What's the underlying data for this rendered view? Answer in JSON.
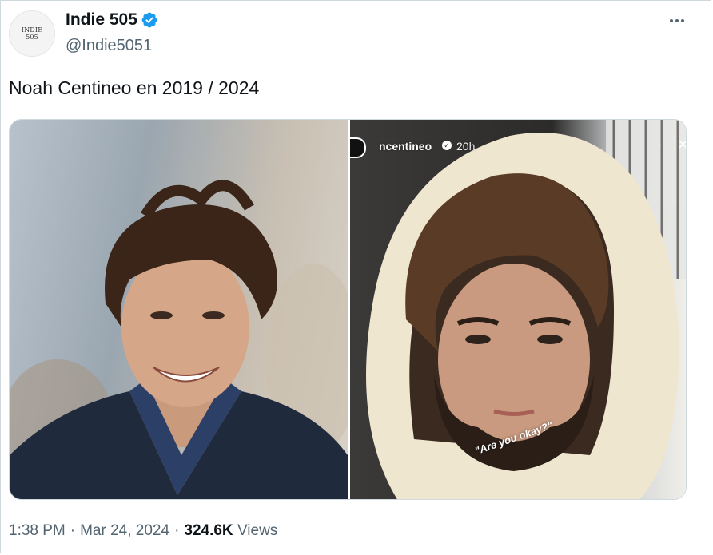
{
  "author": {
    "avatar_text_line1": "INDIE",
    "avatar_text_line2": "505",
    "display_name": "Indie 505",
    "handle": "@Indie5051",
    "verified_icon": "verified-badge-icon",
    "verified_color": "#1d9bf0"
  },
  "menu": {
    "more_icon": "more-horizontal-icon"
  },
  "tweet": {
    "text": "Noah Centineo en 2019 / 2024"
  },
  "media": {
    "left_photo": "photo-2019",
    "right_photo": {
      "story_username": "ncentineo",
      "story_verified": "✓",
      "story_time": "20h",
      "story_more": "···",
      "story_close": "×",
      "caption": "\"Are you okay?\""
    }
  },
  "meta": {
    "time": "1:38 PM",
    "separator1": "·",
    "date": "Mar 24, 2024",
    "separator2": "·",
    "views_count": "324.6K",
    "views_label": "Views"
  },
  "colors": {
    "text_primary": "#0f1419",
    "text_secondary": "#536471",
    "border": "#cfd9de"
  }
}
